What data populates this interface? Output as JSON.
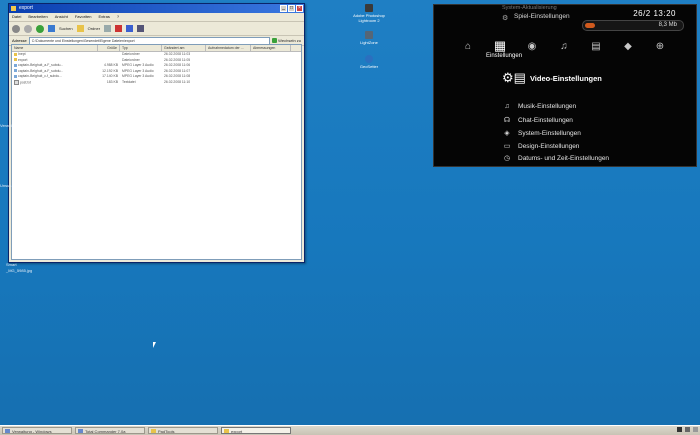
{
  "explorer": {
    "title": "export",
    "menu": [
      "Datei",
      "Bearbeiten",
      "Ansicht",
      "Favoriten",
      "Extras",
      "?"
    ],
    "toolbar": {
      "search": "Suchen",
      "folders": "Ordner"
    },
    "address_label": "Adresse",
    "address_value": "C:\\Dokumente und Einstellungen\\Gesendet\\Eigene Dateien\\export",
    "go_label": "Wechseln zu",
    "columns": [
      "Name",
      "Größe",
      "Typ",
      "Geändert am",
      "Aufnahmedatum der ...",
      "Abmessungen"
    ],
    "files": [
      {
        "name": "Inept",
        "size": "",
        "type": "Dateiordner",
        "modified": "26.02.2008 11:03",
        "icon": "folder"
      },
      {
        "name": "export",
        "size": "",
        "type": "Dateiordner",
        "modified": "26.02.2008 11:05",
        "icon": "folder"
      },
      {
        "name": "captain-Beighuit_a-F_subdu...",
        "size": "4.988 KB",
        "type": "MPEG Layer 3 Audio",
        "modified": "26.02.2008 11:06",
        "icon": "audio"
      },
      {
        "name": "captain-Beighuit_a-F_subdu...",
        "size": "12.192 KB",
        "type": "MPEG Layer 3 Audio",
        "modified": "26.02.2008 11:07",
        "icon": "audio"
      },
      {
        "name": "captain-Beighuit_c-f_subdu...",
        "size": "17.140 KB",
        "type": "MPEG Layer 3 Audio",
        "modified": "26.02.2008 11:08",
        "icon": "audio"
      },
      {
        "name": "post.txt",
        "size": "183 KB",
        "type": "Textdatei",
        "modified": "26.02.2008 11:10",
        "icon": "txt"
      }
    ]
  },
  "desktop": {
    "icons": [
      {
        "label": "Adobe Photoshop Lightroom 2",
        "color": "#3a3a3a"
      },
      {
        "label": "LightZone",
        "color": "#556677"
      },
      {
        "label": "GeoSetter",
        "color": "#2b6fbf"
      }
    ],
    "side_labels": [
      "Verwal",
      "Unsus",
      "Smart"
    ],
    "file_label": "_MG_5985.jpg"
  },
  "ps3": {
    "top_item": "System-Aktualisierung",
    "top_item2": "Spiel-Einstellungen",
    "clock": "26/2 13:20",
    "storage": "8,3 Mb",
    "storage_fill": 0.1,
    "xmb_categories": [
      "⌂",
      "▦",
      "◉",
      "♫",
      "▤",
      "◆",
      "⊕"
    ],
    "current_category": "Einstellungen",
    "selected": "Video-Einstellungen",
    "items": [
      "Musik-Einstellungen",
      "Chat-Einstellungen",
      "System-Einstellungen",
      "Design-Einstellungen",
      "Datums- und Zeit-Einstellungen"
    ]
  },
  "taskbar": {
    "tasks": [
      "Verwaltung - Windows",
      "Total Commander 7.0a",
      "PadTools",
      "export"
    ],
    "active_index": 3
  }
}
